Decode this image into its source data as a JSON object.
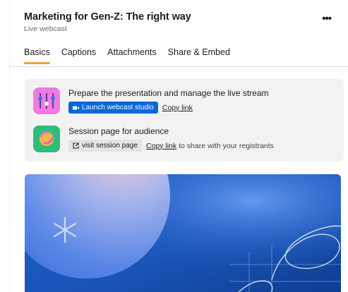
{
  "header": {
    "title": "Marketing for Gen-Z: The right way",
    "subtitle": "Live webcast",
    "more_icon": "more-horizontal-icon",
    "more_label": "•••"
  },
  "tabs": [
    {
      "label": "Basics",
      "active": true
    },
    {
      "label": "Captions",
      "active": false
    },
    {
      "label": "Attachments",
      "active": false
    },
    {
      "label": "Share & Embed",
      "active": false
    }
  ],
  "studio": {
    "title": "Prepare the presentation and manage the live stream",
    "primary_button": "Launch webcast studio",
    "copy_link": "Copy link",
    "icon": "sliders-icon"
  },
  "session": {
    "title": "Session page for audience",
    "visit_button": "visit session page",
    "copy_link": "Copy link",
    "copy_suffix": "to share with your registrants",
    "icon": "session-page-icon"
  },
  "colors": {
    "accent": "#e9a43a",
    "primary": "#0a67d7",
    "studio_icon_bg": "#f07be0",
    "session_icon_bg": "#2ebd7a"
  }
}
